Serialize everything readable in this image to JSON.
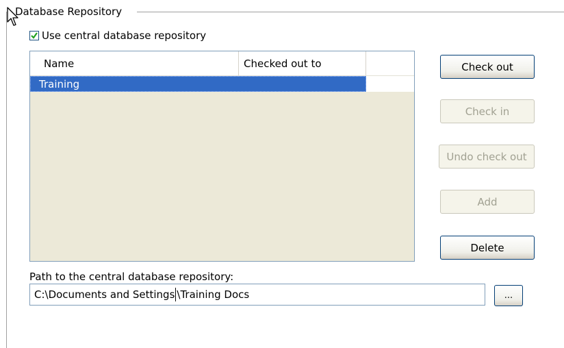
{
  "group": {
    "title": "Database Repository"
  },
  "use_central": {
    "label": "Use central database repository",
    "checked": true
  },
  "list": {
    "columns": [
      "Name",
      "Checked out to"
    ],
    "rows": [
      {
        "name": "Training",
        "checked_out_to": "",
        "selected": true
      }
    ]
  },
  "buttons": {
    "check_out": "Check out",
    "check_in": "Check in",
    "undo_check_out": "Undo check out",
    "add": "Add",
    "delete": "Delete",
    "browse": "..."
  },
  "path": {
    "label": "Path to the central database repository:",
    "value_before_caret": "C:\\Documents and Settings",
    "value_after_caret": "\\Training Docs"
  },
  "icons": {
    "checkbox": "checkmark-icon",
    "cursor": "mouse-pointer-icon"
  },
  "colors": {
    "selection": "#316ac5",
    "list_bg": "#ece9d8",
    "checkmark": "#21a121",
    "button_border": "#003c74"
  }
}
